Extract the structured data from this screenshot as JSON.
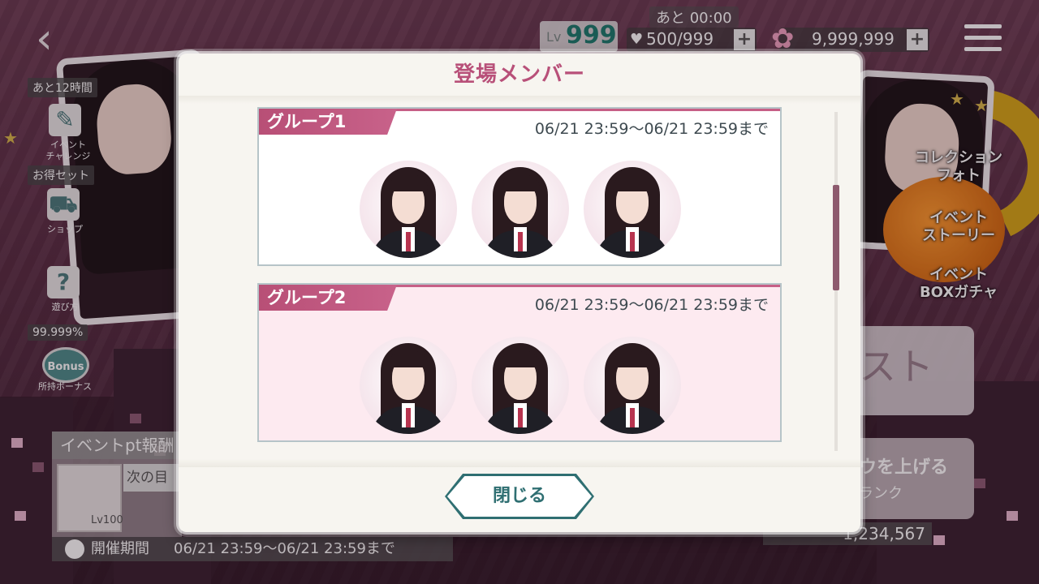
{
  "background": {
    "timer": "あと 00:00",
    "level_prefix": "Lv",
    "level": "999",
    "stamina": "500/999",
    "coins": "9,999,999",
    "left_tags": {
      "time_left": "あと12時間",
      "event_challenge": "イベント\nチャレンジ",
      "deal_set": "お得セット",
      "shop": "ショップ",
      "how_to_play": "遊び方",
      "bonus_percent": "99.999%",
      "bonus_badge": "Bonus",
      "bonus_label": "所持ボーナス"
    },
    "right_menu": {
      "collection_photo": "コレクション\nフォト",
      "event_story": "イベント\nストーリー",
      "event_box_gacha": "イベント\nBOXガチャ",
      "quest_partial": "スト",
      "rank_up_partial": "ウを上げる",
      "rank_partial": "ランク"
    },
    "event_pt": {
      "title": "イベントpt報酬",
      "item_level": "Lv100",
      "next_goal": "次の目"
    },
    "period_key": "開催期間",
    "period_value": "06/21 23:59〜06/21 23:59まで",
    "points": "1,234,567"
  },
  "dialog": {
    "title": "登場メンバー",
    "groups": [
      {
        "name": "グループ1",
        "period": "06/21 23:59〜06/21 23:59まで"
      },
      {
        "name": "グループ2",
        "period": "06/21 23:59〜06/21 23:59まで"
      }
    ],
    "close_label": "閉じる"
  },
  "colors": {
    "title_pink": "#b85079",
    "tab_pink": "#c65f86",
    "teal": "#2f6f72",
    "scroll_thumb": "#8d5a6e"
  }
}
